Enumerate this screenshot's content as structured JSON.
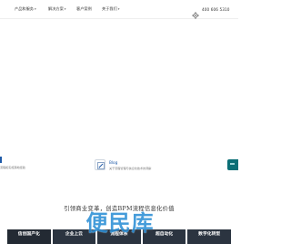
{
  "nav": {
    "items": [
      {
        "label": "产品和服务",
        "caret": "▾"
      },
      {
        "label": "解决方案",
        "caret": "▾"
      },
      {
        "label": "客户案例",
        "caret": ""
      },
      {
        "label": "关于我们",
        "caret": "▾"
      }
    ],
    "phone": "400 606 5310",
    "phone_icon": "phone-gear-icon"
  },
  "hero": {
    "left_card": {
      "title": "",
      "desc": "流程和实施落地经验"
    },
    "blog_card": {
      "icon": "blog-icon",
      "title": "Blog",
      "desc": "关于流程管理与信息化技术的洞察"
    },
    "side_tab_color": "#0b6f76"
  },
  "slogan": "引领商业变革，创造BPM流程信息化价值",
  "tabs": [
    {
      "label": "信创国产化"
    },
    {
      "label": "企业上云"
    },
    {
      "label": "流程体系"
    },
    {
      "label": "超自动化"
    },
    {
      "label": "数字化转型"
    }
  ],
  "watermark": "便民库",
  "colors": {
    "accent": "#1e5aa8",
    "tab_bg": "#2b3440",
    "watermark": "#2c8fd6"
  }
}
